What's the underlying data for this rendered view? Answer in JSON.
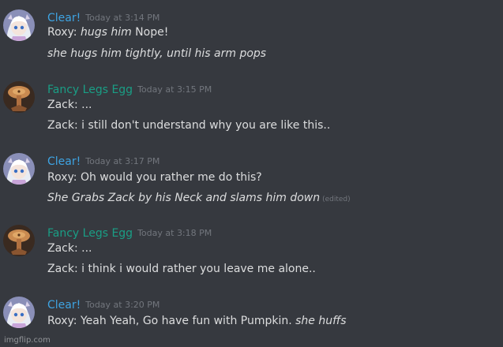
{
  "messages": [
    {
      "user": "Clear!",
      "time": "Today at 3:14 PM",
      "avatar": "anime-girl-avatar",
      "color": "#3ea4e3",
      "l1_a": "Roxy: ",
      "l1_b": "hugs him",
      "l1_c": " Nope!",
      "l2": "she hugs him tightly, until his arm pops"
    },
    {
      "user": "Fancy Legs Egg",
      "time": "Today at 3:15 PM",
      "avatar": "egg-avatar",
      "color": "#1a9e85",
      "l1": "Zack: ...",
      "l2": "Zack: i still don't understand why you are like this.."
    },
    {
      "user": "Clear!",
      "time": "Today at 3:17 PM",
      "avatar": "anime-girl-avatar",
      "color": "#3ea4e3",
      "l1": "Roxy: Oh would you rather me do this?",
      "l2": "She Grabs Zack by his Neck and slams him down",
      "edited": "(edited)"
    },
    {
      "user": "Fancy Legs Egg",
      "time": "Today at 3:18 PM",
      "avatar": "egg-avatar",
      "color": "#1a9e85",
      "l1": "Zack: ...",
      "l2": "Zack: i think i would rather you leave me alone.."
    },
    {
      "user": "Clear!",
      "time": "Today at 3:20 PM",
      "avatar": "anime-girl-avatar",
      "color": "#3ea4e3",
      "l1_a": "Roxy: Yeah Yeah, Go have fun with Pumpkin. ",
      "l1_b": "she huffs"
    }
  ],
  "watermark": "imgflip.com"
}
